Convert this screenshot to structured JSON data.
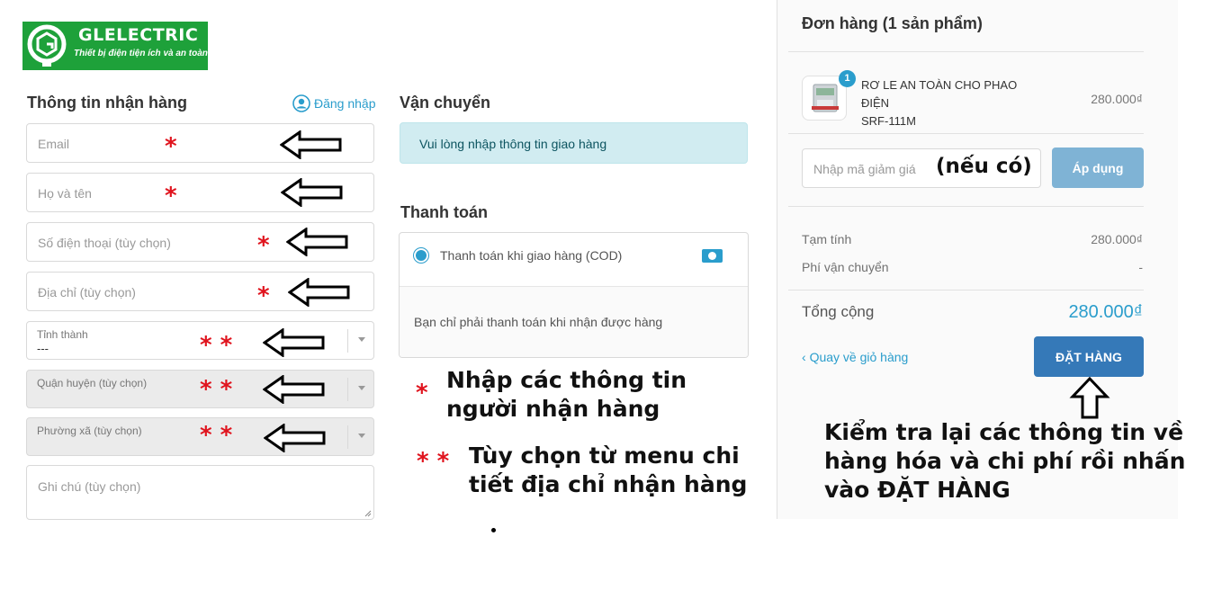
{
  "brand": {
    "name": "GLELECTRIC",
    "tagline": "Thiết bị điện tiện ích và an toàn",
    "color": "#1ea13a"
  },
  "receiver": {
    "title": "Thông tin nhận hàng",
    "login_label": "Đăng nhập",
    "email_placeholder": "Email",
    "name_placeholder": "Họ và tên",
    "phone_placeholder": "Số điện thoại (tùy chọn)",
    "address_placeholder": "Địa chỉ (tùy chọn)",
    "province_label": "Tỉnh thành",
    "province_value": "---",
    "district_label": "Quận huyện (tùy chọn)",
    "ward_label": "Phường xã (tùy chọn)",
    "note_placeholder": "Ghi chú (tùy chọn)"
  },
  "shipping": {
    "title": "Vận chuyển",
    "message": "Vui lòng nhập thông tin giao hàng"
  },
  "payment": {
    "title": "Thanh toán",
    "method_label": "Thanh toán khi giao hàng (COD)",
    "method_detail": "Bạn chỉ phải thanh toán khi nhận được hàng",
    "icon": "cash-icon"
  },
  "annotations": {
    "star_single": "*",
    "star_double": "* *",
    "legend_single_line1": "Nhập các thông tin",
    "legend_single_line2": "người nhận hàng",
    "legend_double_line1": "Tùy chọn từ menu chi",
    "legend_double_line2": "tiết địa chỉ nhận hàng",
    "coupon_note": "(nếu có)",
    "checkout_line1": "Kiểm tra lại các thông tin về",
    "checkout_line2": "hàng hóa và chi phí rồi nhấn",
    "checkout_line3": "vào ĐẶT HÀNG"
  },
  "order": {
    "title": "Đơn hàng (1 sản phẩm)",
    "items": [
      {
        "quantity": "1",
        "name_line1": "RƠ LE AN TOÀN CHO PHAO ĐIỆN",
        "name_line2": "SRF-111M",
        "price": "280.000₫"
      }
    ],
    "coupon_placeholder": "Nhập mã giảm giá",
    "apply_label": "Áp dụng",
    "subtotal_label": "Tạm tính",
    "subtotal_value": "280.000₫",
    "shipping_label": "Phí vận chuyển",
    "shipping_value": "-",
    "total_label": "Tổng cộng",
    "total_value": "280.000₫",
    "back_label": "Quay về giỏ hàng",
    "place_order_label": "ĐẶT HÀNG",
    "accent_color": "#2a9dcc",
    "button_color": "#3579b8"
  }
}
